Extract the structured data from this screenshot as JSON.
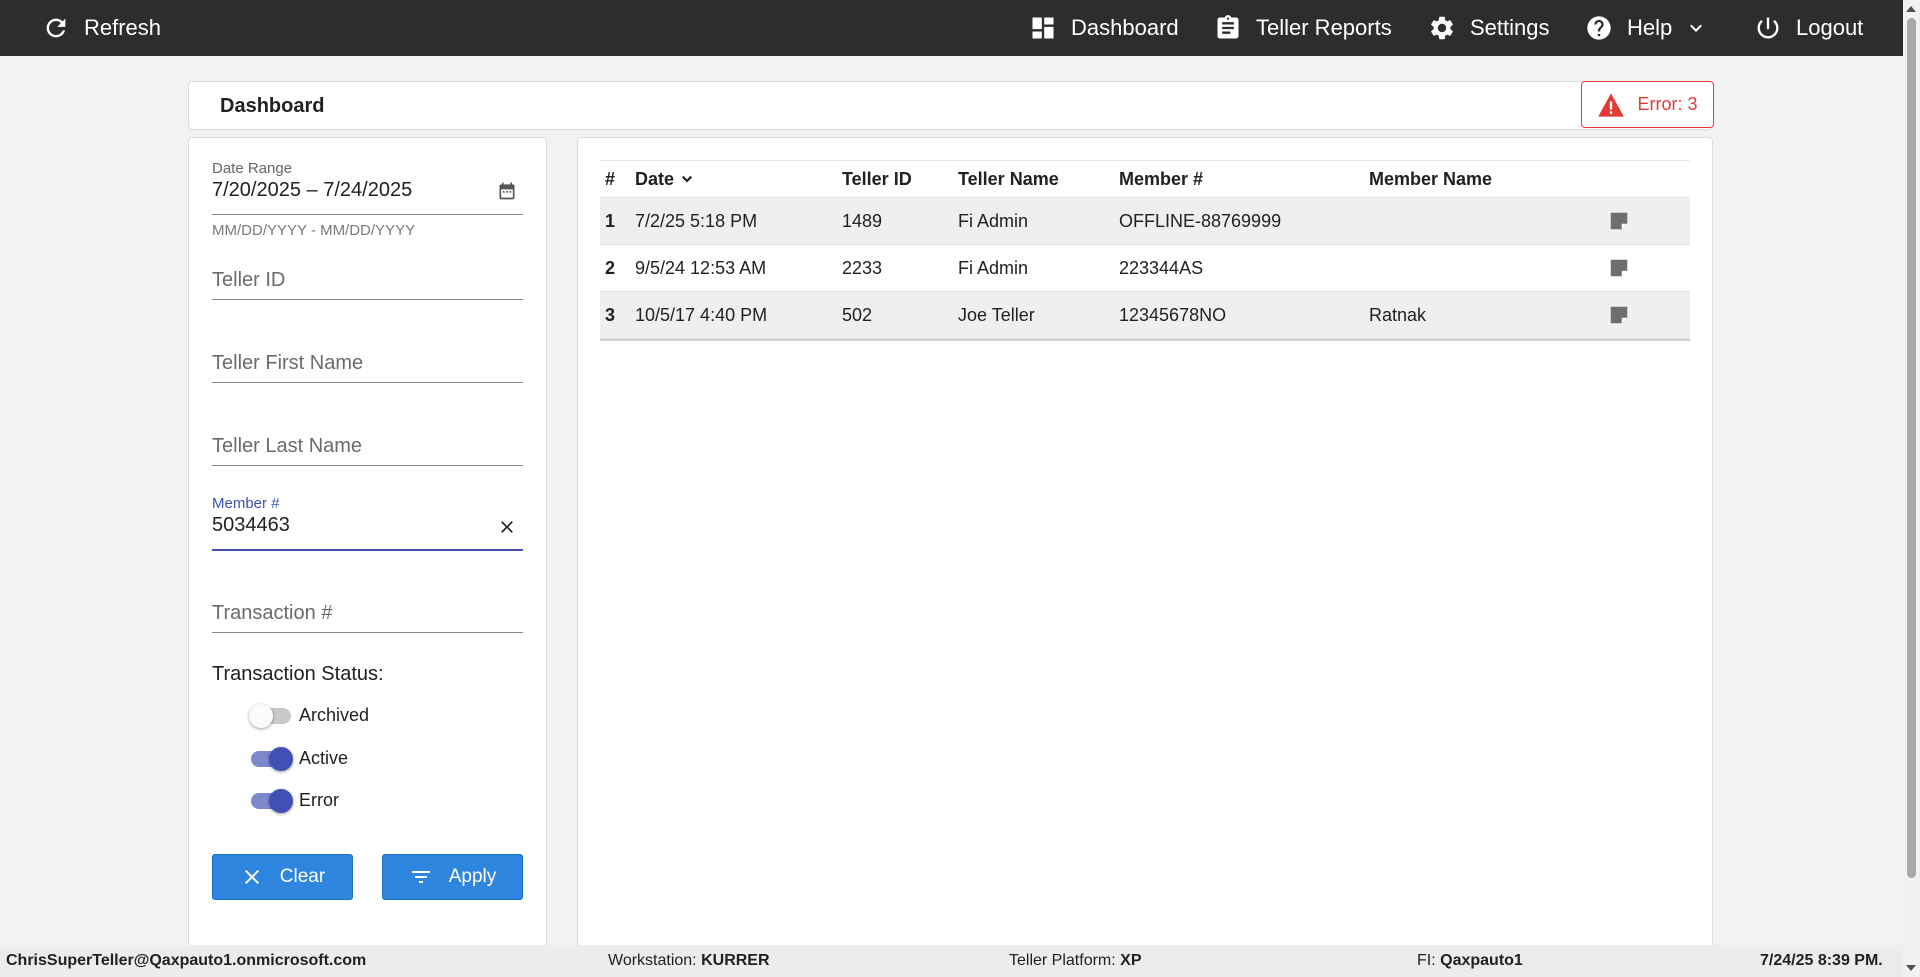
{
  "nav": {
    "refresh_label": "Refresh",
    "dashboard_label": "Dashboard",
    "reports_label": "Teller Reports",
    "settings_label": "Settings",
    "help_label": "Help",
    "logout_label": "Logout"
  },
  "header": {
    "title": "Dashboard",
    "error_badge": "Error: 3",
    "error_color": "#e53935"
  },
  "filters": {
    "date_range": {
      "label": "Date Range",
      "value": "7/20/2025 – 7/24/2025",
      "hint": "MM/DD/YYYY - MM/DD/YYYY"
    },
    "teller_id": {
      "placeholder": "Teller ID"
    },
    "teller_first_name": {
      "placeholder": "Teller First Name"
    },
    "teller_last_name": {
      "placeholder": "Teller Last Name"
    },
    "member_number": {
      "label": "Member #",
      "value": "5034463"
    },
    "transaction_number": {
      "placeholder": "Transaction #"
    },
    "status_title": "Transaction Status:",
    "statuses": [
      {
        "label": "Archived",
        "on": false
      },
      {
        "label": "Active",
        "on": true
      },
      {
        "label": "Error",
        "on": true
      }
    ],
    "clear_label": "Clear",
    "apply_label": "Apply",
    "accent_color": "#3f51b5",
    "button_color": "#2e86de"
  },
  "table": {
    "headers": {
      "index": "#",
      "date": "Date",
      "teller_id": "Teller ID",
      "teller_name": "Teller Name",
      "member_number": "Member #",
      "member_name": "Member Name"
    },
    "rows": [
      {
        "index": "1",
        "date": "7/2/25 5:18 PM",
        "teller_id": "1489",
        "teller_name": "Fi Admin",
        "member_number": "OFFLINE-88769999",
        "member_name": ""
      },
      {
        "index": "2",
        "date": "9/5/24 12:53 AM",
        "teller_id": "2233",
        "teller_name": "Fi Admin",
        "member_number": "223344AS",
        "member_name": ""
      },
      {
        "index": "3",
        "date": "10/5/17 4:40 PM",
        "teller_id": "502",
        "teller_name": "Joe Teller",
        "member_number": "12345678NO",
        "member_name": "Ratnak"
      }
    ]
  },
  "footer": {
    "user": "ChrisSuperTeller@Qaxpauto1.onmicrosoft.com",
    "workstation_label": "Workstation:",
    "workstation": "KURRER",
    "platform_label": "Teller Platform:",
    "platform": "XP",
    "fi_label": "FI:",
    "fi": "Qaxpauto1",
    "datetime": "7/24/25 8:39 PM."
  }
}
